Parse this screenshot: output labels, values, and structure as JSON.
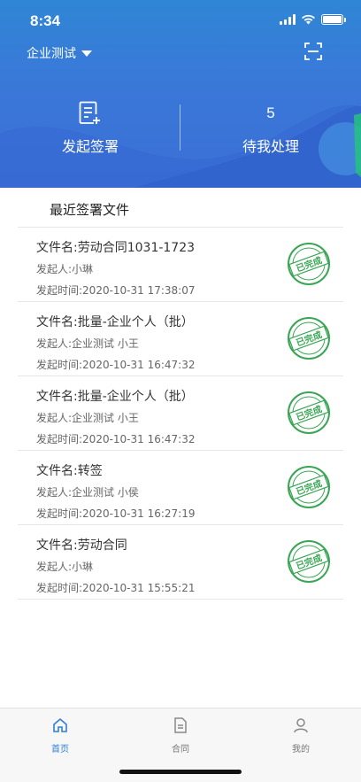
{
  "status_bar": {
    "time": "8:34"
  },
  "header": {
    "company_name": "企业测试",
    "actions": {
      "initiate_label": "发起签署",
      "pending_count": "5",
      "pending_label": "待我处理"
    }
  },
  "recent": {
    "title": "最近签署文件",
    "files": [
      {
        "name": "文件名:劳动合同1031-1723",
        "initiator_label": "发起人:",
        "initiator": "小琳",
        "time": "发起时间:2020-10-31 17:38:07",
        "status": "已完成"
      },
      {
        "name": "文件名:批量-企业个人（批）",
        "initiator_label": "发起人:",
        "initiator": "企业测试 小王",
        "time": "发起时间:2020-10-31 16:47:32",
        "status": "已完成"
      },
      {
        "name": "文件名:批量-企业个人（批）",
        "initiator_label": "发起人:",
        "initiator": "企业测试 小王",
        "time": "发起时间:2020-10-31 16:47:32",
        "status": "已完成"
      },
      {
        "name": "文件名:转签",
        "initiator_label": "发起人:",
        "initiator": "企业测试 小侯",
        "time": "发起时间:2020-10-31 16:27:19",
        "status": "已完成"
      },
      {
        "name": "文件名:劳动合同",
        "initiator_label": "发起人:",
        "initiator": "小琳",
        "time": "发起时间:2020-10-31 15:55:21",
        "status": "已完成"
      }
    ]
  },
  "tabbar": {
    "home": "首页",
    "contract": "合同",
    "mine": "我的"
  },
  "colors": {
    "header_blue": "#3a78d8",
    "accent": "#2f7fd8",
    "stamp_green": "#3aa655"
  }
}
